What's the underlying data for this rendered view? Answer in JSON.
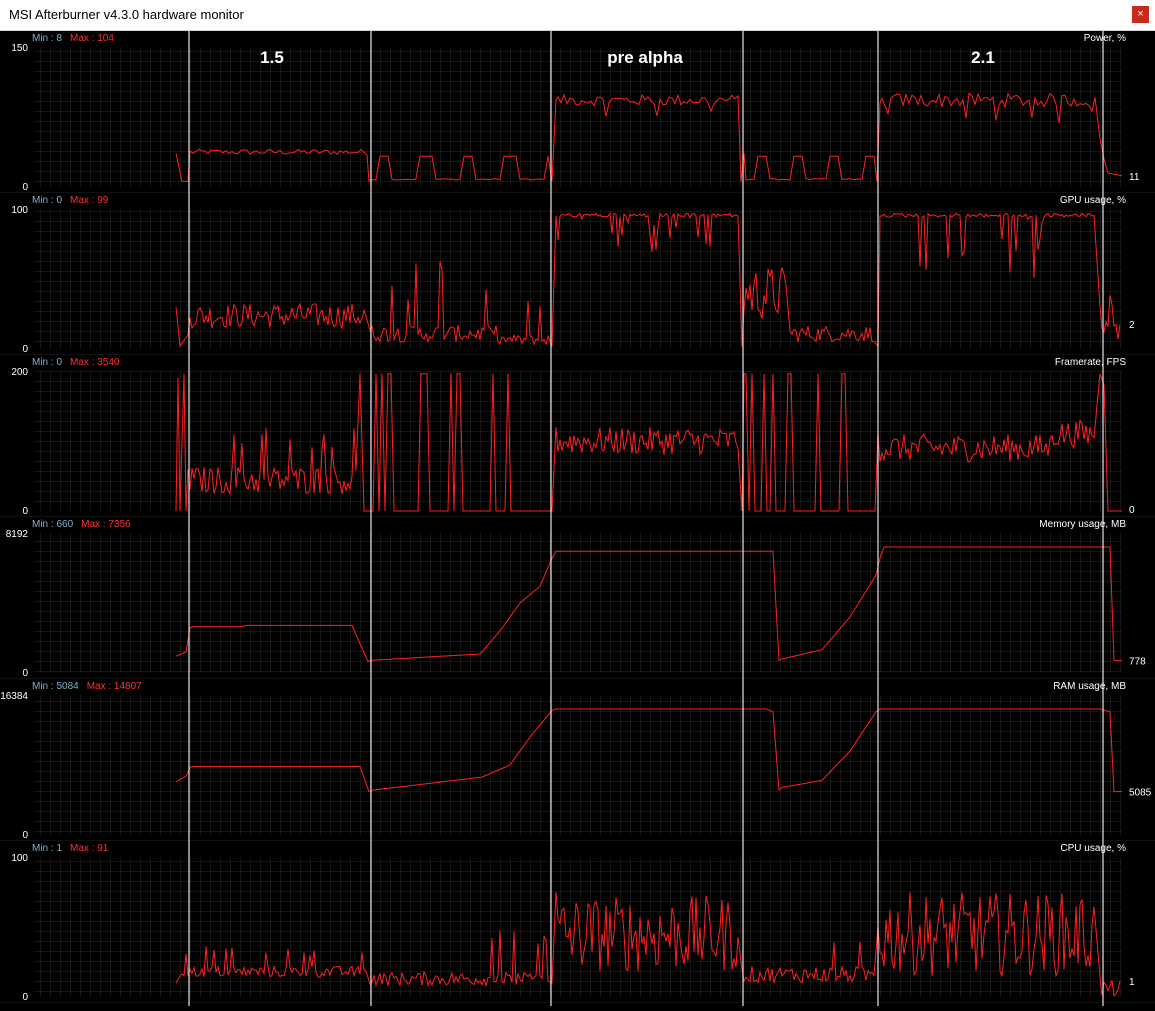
{
  "window": {
    "title": "MSI Afterburner v4.3.0 hardware monitor",
    "close_label": "×"
  },
  "colors": {
    "trace": "#ff2020",
    "min_label": "#7fb2c8",
    "max_label": "#ff3030",
    "grid": "#2a2a2a",
    "axis_text": "#ffffff",
    "marker": "#ffffff"
  },
  "markers": {
    "labels": [
      {
        "text": "1.5"
      },
      {
        "text": "pre alpha"
      },
      {
        "text": "2.1"
      }
    ]
  },
  "graphs": [
    {
      "name": "Power, %",
      "min_label": "Min : 8",
      "max_label": "Max : 104",
      "y_top": "150",
      "y_bottom": "0",
      "current": "11"
    },
    {
      "name": "GPU usage, %",
      "min_label": "Min : 0",
      "max_label": "Max : 99",
      "y_top": "100",
      "y_bottom": "0",
      "current": "2"
    },
    {
      "name": "Framerate, FPS",
      "min_label": "Min : 0",
      "max_label": "Max : 3540",
      "y_top": "200",
      "y_bottom": "0",
      "current": "0"
    },
    {
      "name": "Memory usage, MB",
      "min_label": "Min : 660",
      "max_label": "Max : 7356",
      "y_top": "8192",
      "y_bottom": "0",
      "current": "778"
    },
    {
      "name": "RAM usage, MB",
      "min_label": "Min : 5084",
      "max_label": "Max : 14807",
      "y_top": "16384",
      "y_bottom": "0",
      "current": "5085"
    },
    {
      "name": "CPU usage, %",
      "min_label": "Min : 1",
      "max_label": "Max : 91",
      "y_top": "100",
      "y_bottom": "0",
      "current": "1"
    }
  ]
}
